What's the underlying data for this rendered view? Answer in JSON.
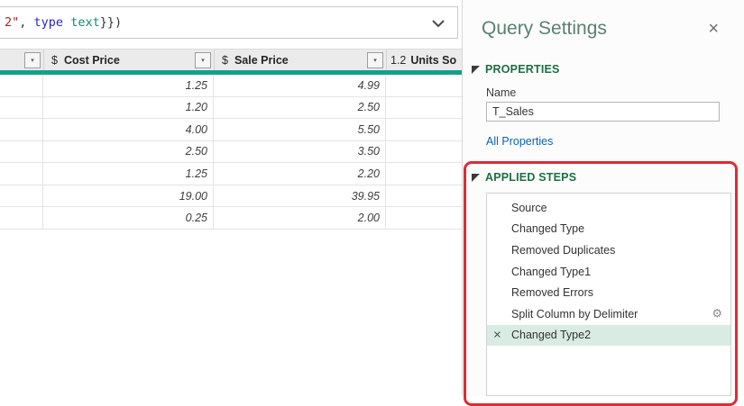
{
  "formula_bar": {
    "tokens": [
      {
        "text": "2\"",
        "color": "#b22222"
      },
      {
        "text": ", ",
        "color": "#333333"
      },
      {
        "text": "type",
        "color": "#2525d6"
      },
      {
        "text": " ",
        "color": "#333333"
      },
      {
        "text": "text",
        "color": "#0f8a7e"
      },
      {
        "text": "}})",
        "color": "#333333"
      }
    ]
  },
  "table": {
    "columns": [
      {
        "type_icon": "",
        "label": ""
      },
      {
        "type_icon": "$",
        "label": "Cost Price"
      },
      {
        "type_icon": "$",
        "label": "Sale Price"
      },
      {
        "type_icon": "1.2",
        "label": "Units So"
      }
    ],
    "rows": [
      {
        "cost": "1.25",
        "sale": "4.99"
      },
      {
        "cost": "1.20",
        "sale": "2.50"
      },
      {
        "cost": "4.00",
        "sale": "5.50"
      },
      {
        "cost": "2.50",
        "sale": "3.50"
      },
      {
        "cost": "1.25",
        "sale": "2.20"
      },
      {
        "cost": "19.00",
        "sale": "39.95"
      },
      {
        "cost": "0.25",
        "sale": "2.00"
      }
    ]
  },
  "panel": {
    "title": "Query Settings",
    "close_glyph": "×",
    "properties": {
      "header": "PROPERTIES",
      "name_label": "Name",
      "name_value": "T_Sales",
      "all_properties_link": "All Properties"
    },
    "applied_steps": {
      "header": "APPLIED STEPS",
      "steps": [
        {
          "label": "Source",
          "selected": false,
          "gear": false,
          "deletable": false
        },
        {
          "label": "Changed Type",
          "selected": false,
          "gear": false,
          "deletable": false
        },
        {
          "label": "Removed Duplicates",
          "selected": false,
          "gear": false,
          "deletable": false
        },
        {
          "label": "Changed Type1",
          "selected": false,
          "gear": false,
          "deletable": false
        },
        {
          "label": "Removed Errors",
          "selected": false,
          "gear": false,
          "deletable": false
        },
        {
          "label": "Split Column by Delimiter",
          "selected": false,
          "gear": true,
          "deletable": false
        },
        {
          "label": "Changed Type2",
          "selected": true,
          "gear": false,
          "deletable": true
        }
      ]
    }
  },
  "icons": {
    "filter_dropdown": "▾",
    "formula_expand": "chevron-down",
    "gear": "⚙",
    "delete_step": "×"
  },
  "colors": {
    "accent_teal": "#14a08c",
    "section_header_green": "#1e6e44",
    "link_blue": "#0b62ad",
    "annotation_red": "#dd2c34",
    "selected_step_bg": "#d8ece3",
    "panel_title_green": "#59816f"
  }
}
